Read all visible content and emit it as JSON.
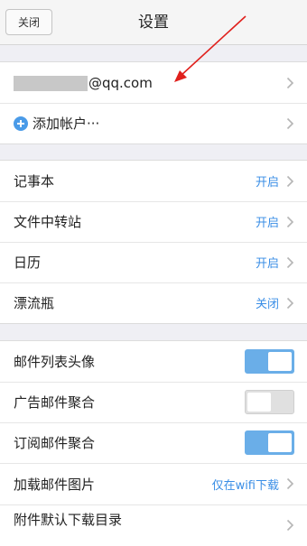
{
  "header": {
    "close_label": "关闭",
    "title": "设置"
  },
  "account": {
    "email_suffix": "@qq.com",
    "add_label": "添加帐户···"
  },
  "apps": [
    {
      "label": "记事本",
      "status": "开启"
    },
    {
      "label": "文件中转站",
      "status": "开启"
    },
    {
      "label": "日历",
      "status": "开启"
    },
    {
      "label": "漂流瓶",
      "status": "关闭"
    }
  ],
  "mail_settings": {
    "avatar_label": "邮件列表头像",
    "avatar_on": true,
    "ads_label": "广告邮件聚合",
    "ads_on": false,
    "subscription_label": "订阅邮件聚合",
    "subscription_on": true,
    "images_label": "加载邮件图片",
    "images_value": "仅在wifi下载",
    "download_dir_label": "附件默认下载目录"
  },
  "colors": {
    "accent": "#3a8ee6",
    "toggle_on": "#6aaee8",
    "annotation_arrow": "#e0201c"
  }
}
